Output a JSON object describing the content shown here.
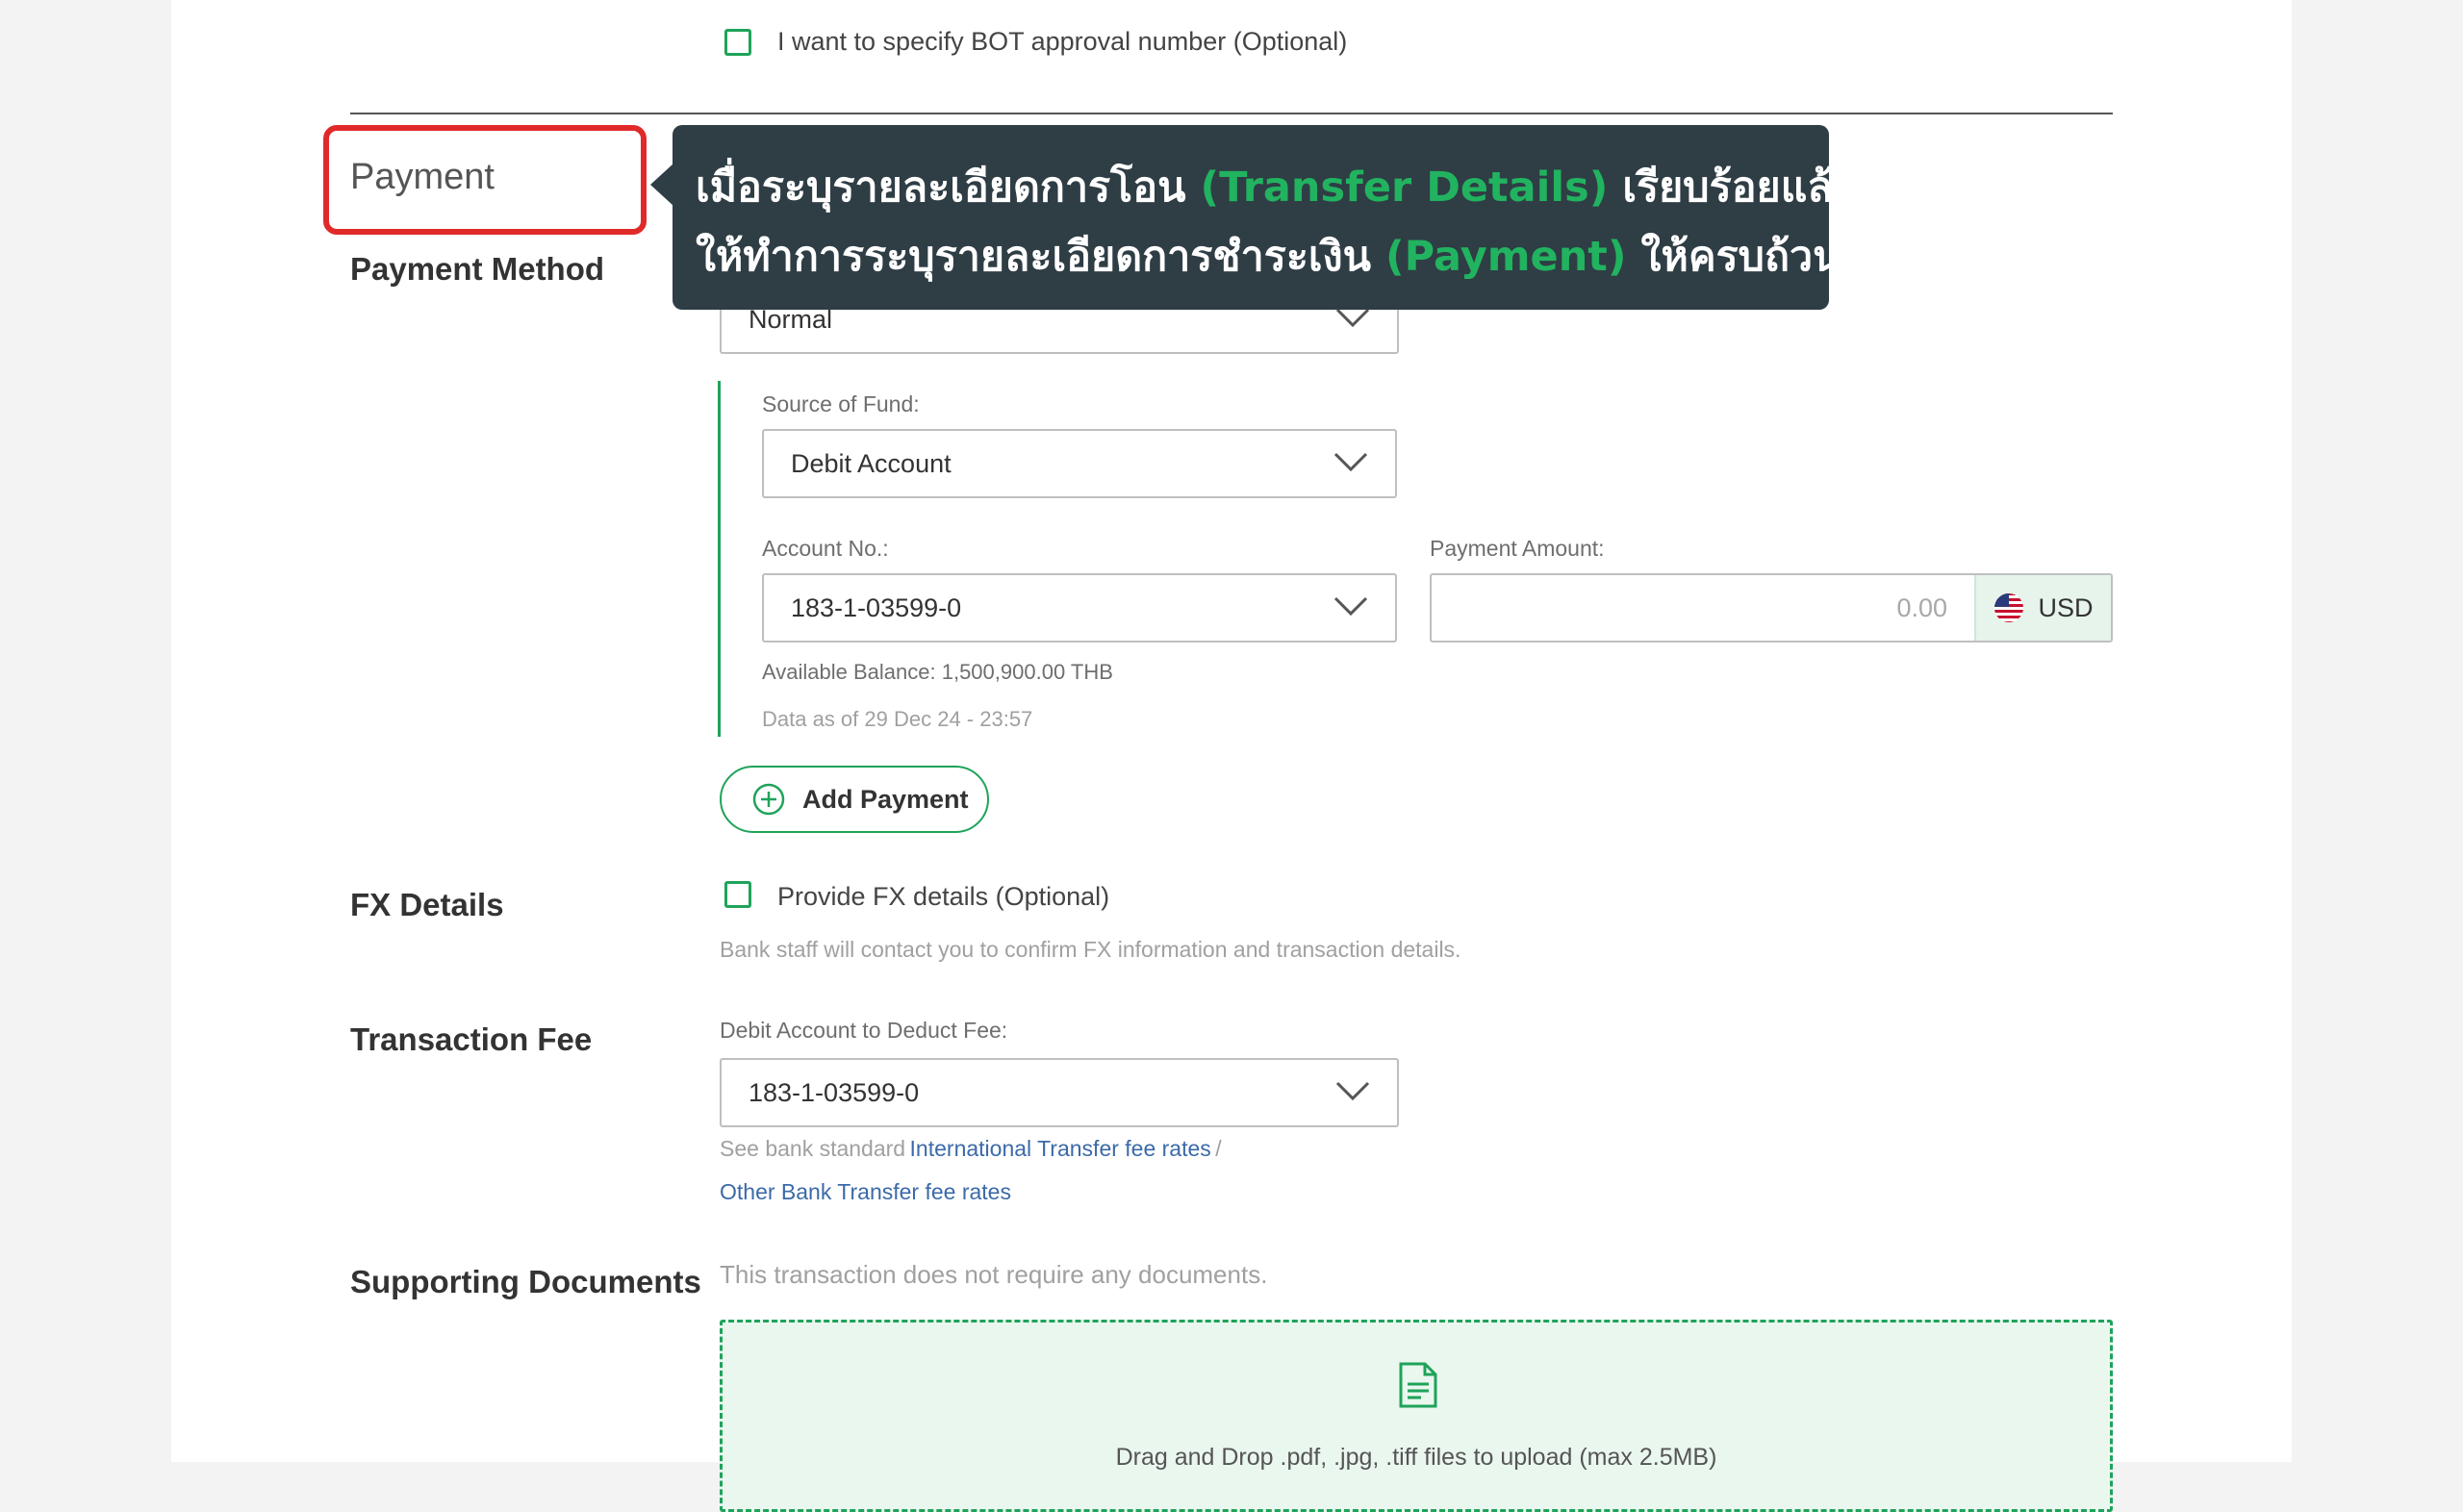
{
  "bot_checkbox": {
    "label": "I want to specify BOT approval number (Optional)"
  },
  "payment": {
    "title": "Payment",
    "method_label": "Payment Method",
    "method_value": "Normal",
    "source_label": "Source of Fund:",
    "source_value": "Debit Account",
    "account_label": "Account No.:",
    "account_value": "183-1-03599-0",
    "amount_label": "Payment Amount:",
    "amount_placeholder": "0.00",
    "currency": "USD",
    "available_balance": "Available Balance: 1,500,900.00 THB",
    "data_as_of": "Data as of 29 Dec 24 - 23:57",
    "add_button": "Add Payment"
  },
  "fx": {
    "title": "FX Details",
    "checkbox_label": "Provide FX details (Optional)",
    "note": "Bank staff will contact you to confirm FX information and transaction details."
  },
  "fee": {
    "title": "Transaction Fee",
    "account_label": "Debit Account to Deduct Fee:",
    "account_value": "183-1-03599-0",
    "see_text": "See bank standard",
    "link_international": "International Transfer fee rates",
    "separator": "/",
    "link_other": "Other Bank Transfer fee rates"
  },
  "documents": {
    "title": "Supporting Documents",
    "note": "This transaction does not require any documents.",
    "dropzone_text": "Drag and Drop .pdf, .jpg, .tiff files to upload (max 2.5MB)"
  },
  "tooltip": {
    "line1_a": "เมื่อระบุรายละเอียดการโอน ",
    "line1_hl": "(Transfer Details)",
    "line1_b": " เรียบร้อยแล้ว",
    "line2_a": "ให้ทำการระบุรายละเอียดการชำระเงิน ",
    "line2_hl": "(Payment)",
    "line2_b": " ให้ครบถ้วน"
  },
  "colors": {
    "accent_green": "#1fa35a",
    "highlight_red": "#e02a2a",
    "tooltip_bg": "#2f3d45",
    "link_blue": "#3b6aa8"
  }
}
